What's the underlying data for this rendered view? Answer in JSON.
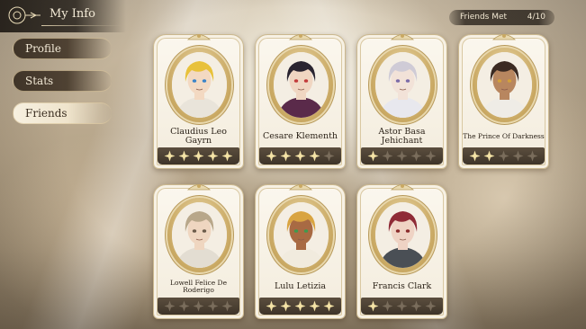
{
  "header": {
    "title": "My Info"
  },
  "menu": {
    "items": [
      {
        "label": "Profile",
        "active": false
      },
      {
        "label": "Stats",
        "active": false
      },
      {
        "label": "Friends",
        "active": true
      }
    ]
  },
  "counter": {
    "label": "Friends Met",
    "value": "4/10"
  },
  "colors": {
    "star_on": "#f4e3a6",
    "star_off": "#7a6d5c",
    "bar": "#4a3f33",
    "frame_gold": "#c9a862"
  },
  "friends": [
    {
      "name": "Claudius Leo Gayrn",
      "stars": 5,
      "max_stars": 5,
      "hair": "#e8c13a",
      "skin": "#f3d9c2",
      "eyes": "#3a84c9",
      "clothes": "#e9e4da"
    },
    {
      "name": "Cesare Klementh",
      "stars": 4,
      "max_stars": 5,
      "hair": "#2a2430",
      "skin": "#f0d6c2",
      "eyes": "#c23a3a",
      "clothes": "#5a2a4a"
    },
    {
      "name": "Astor Basa Jehichant",
      "stars": 1,
      "max_stars": 5,
      "hair": "#cfcbd6",
      "skin": "#f2e2d8",
      "eyes": "#7a6aa8",
      "clothes": "#e8e8ee"
    },
    {
      "name": "The Prince Of Darkness",
      "stars": 2,
      "max_stars": 5,
      "hair": "#3b2a22",
      "skin": "#b8865f",
      "eyes": "#d4a13a",
      "clothes": "#efece6"
    },
    {
      "name": "Lowell Felice De Roderigo",
      "stars": 0,
      "max_stars": 5,
      "hair": "#b8a78a",
      "skin": "#efd6c0",
      "eyes": "#6b5b4a",
      "clothes": "#e3ddd2"
    },
    {
      "name": "Lulu Letizia",
      "stars": 5,
      "max_stars": 5,
      "hair": "#d9a441",
      "skin": "#a86a43",
      "eyes": "#3f9a4e",
      "clothes": "#f1ebde"
    },
    {
      "name": "Francis Clark",
      "stars": 1,
      "max_stars": 5,
      "hair": "#8f2b36",
      "skin": "#efd3c4",
      "eyes": "#8a2a2a",
      "clothes": "#4a4f55"
    }
  ]
}
